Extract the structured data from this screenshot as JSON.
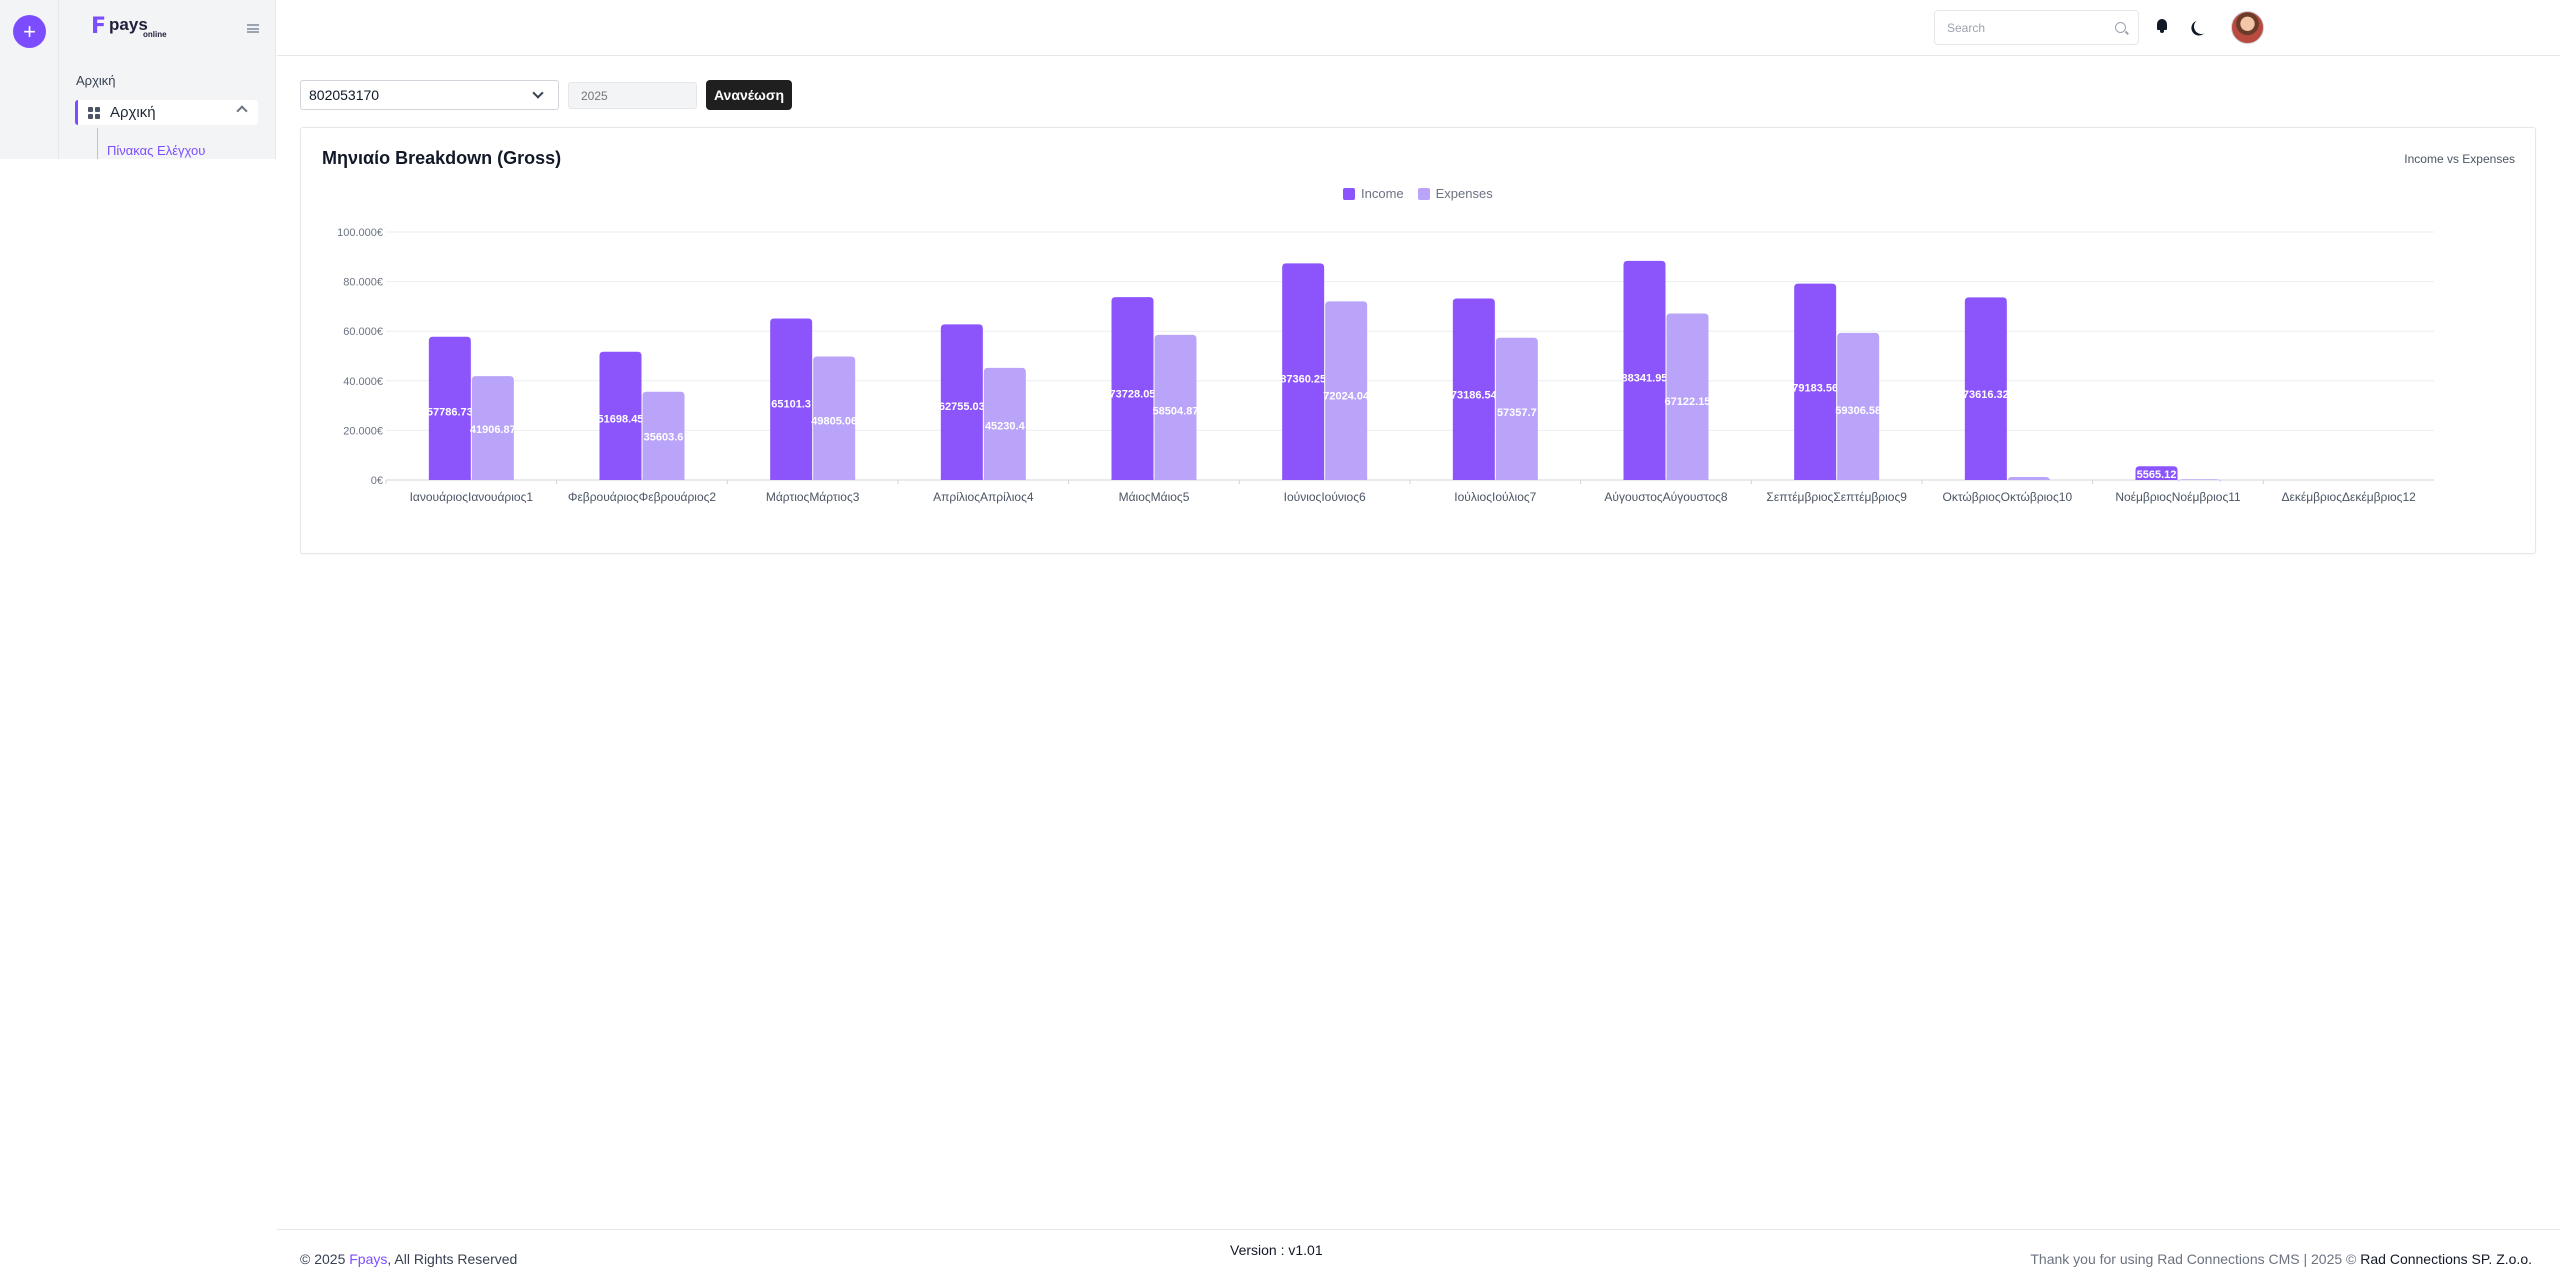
{
  "rail": {
    "add_button": "+"
  },
  "sidebar": {
    "logo_mark": "F",
    "logo_word": "pays",
    "logo_sub": "online",
    "section_label": "Αρχική",
    "active_item": "Αρχική",
    "sub_item": "Πίνακας Ελέγχου"
  },
  "header": {
    "search_placeholder": "Search"
  },
  "filters": {
    "account": "802053170",
    "year_placeholder": "2025",
    "refresh_label": "Ανανέωση"
  },
  "card": {
    "title": "Μηνιαίο Breakdown (Gross)",
    "subtitle": "Income vs Expenses"
  },
  "chart_data": {
    "type": "bar",
    "categories": [
      "ΙανουάριοςΙανουάριος1",
      "ΦεβρουάριοςΦεβρουάριος2",
      "ΜάρτιοςΜάρτιος3",
      "ΑπρίλιοςΑπρίλιος4",
      "ΜάιοςΜάιος5",
      "ΙούνιοςΙούνιος6",
      "ΙούλιοςΙούλιος7",
      "ΑύγουστοςΑύγουστος8",
      "ΣεπτέμβριοςΣεπτέμβριος9",
      "ΟκτώβριοςΟκτώβριος10",
      "ΝοέμβριοςΝοέμβριος11",
      "ΔεκέμβριοςΔεκέμβριος12"
    ],
    "series": [
      {
        "name": "Income",
        "color": "#8b55fb",
        "values": [
          57786.73,
          51698.45,
          65101.3,
          62755.03,
          73728.05,
          87360.25,
          73186.54,
          88341.95,
          79183.56,
          73616.32,
          5565.12,
          0
        ],
        "labels": [
          "57786.73",
          "51698.45",
          "65101.3",
          "62755.03",
          "73728.05",
          "87360.25",
          "73186.54",
          "88341.95",
          "79183.56",
          "73616.32",
          "5565.12",
          ""
        ]
      },
      {
        "name": "Expenses",
        "color": "#b9a4f9",
        "values": [
          41906.87,
          35603.6,
          49805.06,
          45230.4,
          58504.87,
          72024.04,
          57357.7,
          67122.15,
          59306.58,
          1200,
          300,
          0
        ],
        "labels": [
          "41906.87",
          "35603.6",
          "49805.06",
          "45230.4",
          "58504.87",
          "72024.04",
          "57357.7",
          "67122.15",
          "59306.58",
          "",
          "",
          ""
        ]
      }
    ],
    "yticks": [
      "100.000€",
      "80.000€",
      "60.000€",
      "40.000€",
      "20.000€",
      "0€"
    ],
    "ylim": [
      0,
      100000
    ],
    "grid": true,
    "legend": "top-center"
  },
  "footer": {
    "copyright_prefix": "© 2025",
    "brand": "Fpays",
    "rights": ", All Rights Reserved",
    "version": "Version : v1.01",
    "thanks": "Thank you for using Rad Connections CMS |  2025  ©",
    "org": "Rad Connections SP. Z.o.o."
  }
}
